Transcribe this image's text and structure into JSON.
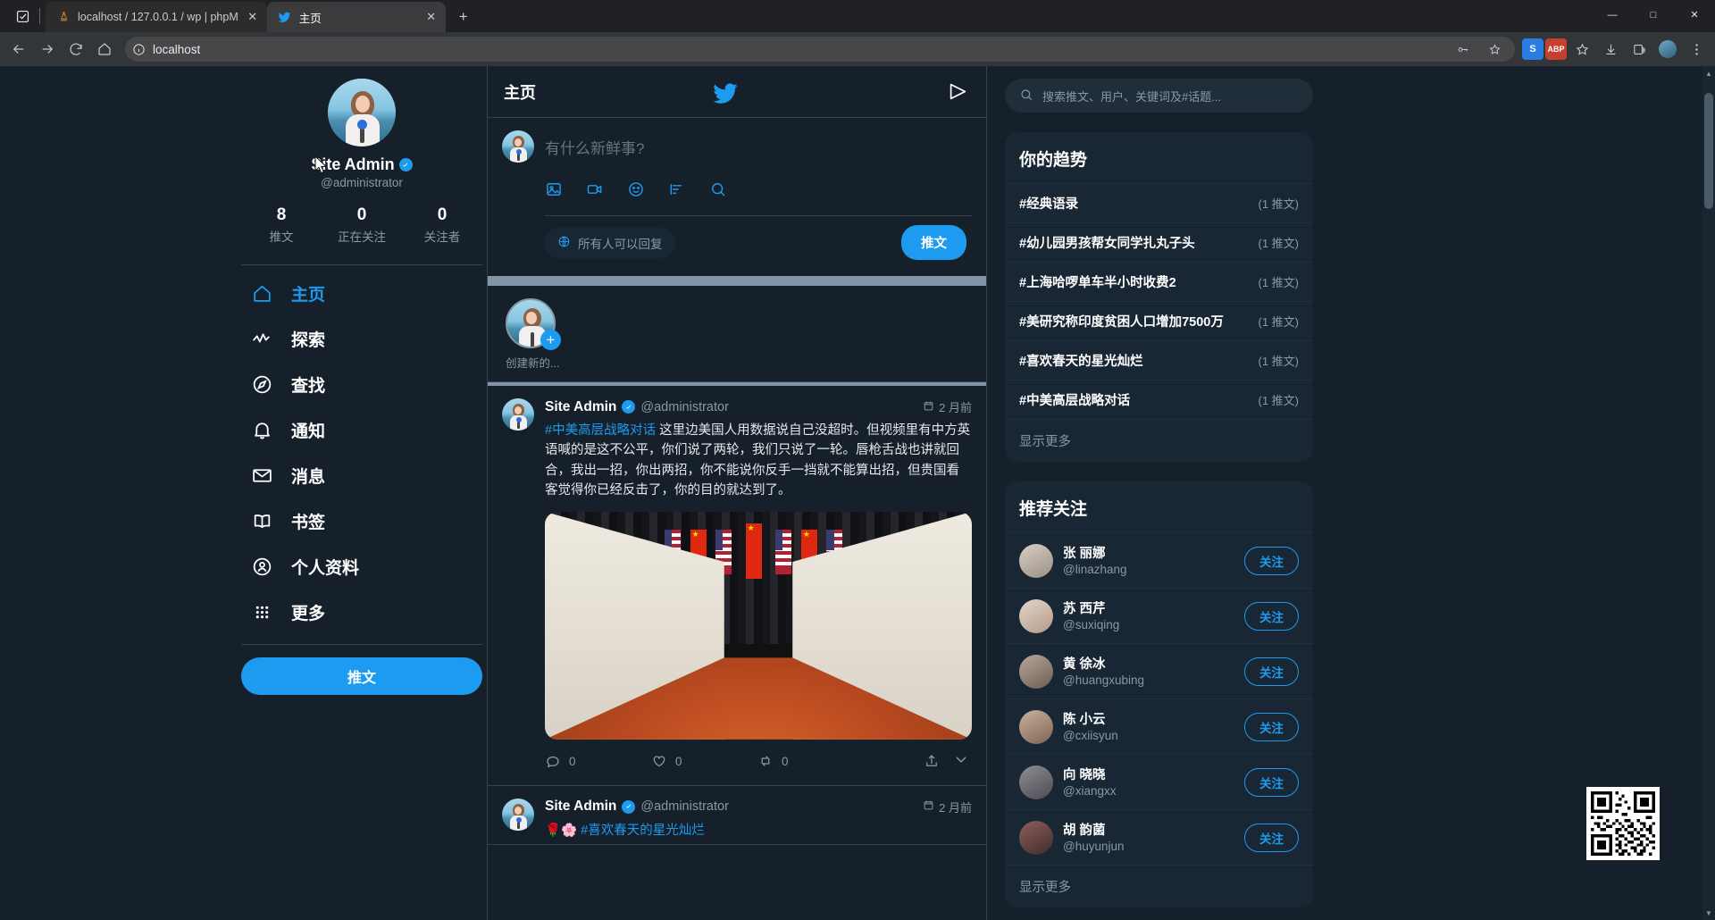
{
  "browser": {
    "tabs": [
      {
        "title": "localhost / 127.0.0.1 / wp | phpM",
        "favicon": "phpmyadmin-icon",
        "active": false
      },
      {
        "title": "主页",
        "favicon": "twitter-bird-icon",
        "active": true
      }
    ],
    "new_tab_label": "+",
    "address": "localhost",
    "window_controls": {
      "minimize": "—",
      "maximize": "□",
      "close": "✕"
    },
    "extensions": [
      {
        "name": "s-extension-icon",
        "label": "S",
        "color": "#2a7de1"
      },
      {
        "name": "abp-extension-icon",
        "label": "ABP",
        "color": "#c3412e"
      }
    ]
  },
  "profile": {
    "display_name": "Site Admin",
    "handle": "@administrator",
    "verified": true,
    "stats": [
      {
        "num": "8",
        "label": "推文"
      },
      {
        "num": "0",
        "label": "正在关注"
      },
      {
        "num": "0",
        "label": "关注者"
      }
    ]
  },
  "nav": {
    "items": [
      {
        "label": "主页",
        "icon": "home-icon",
        "active": true
      },
      {
        "label": "探索",
        "icon": "pulse-icon",
        "active": false
      },
      {
        "label": "查找",
        "icon": "compass-icon",
        "active": false
      },
      {
        "label": "通知",
        "icon": "bell-icon",
        "active": false
      },
      {
        "label": "消息",
        "icon": "mail-icon",
        "active": false
      },
      {
        "label": "书签",
        "icon": "bookmark-icon",
        "active": false
      },
      {
        "label": "个人资料",
        "icon": "person-icon",
        "active": false
      },
      {
        "label": "更多",
        "icon": "grid-dots-icon",
        "active": false
      }
    ],
    "tweet_button": "推文"
  },
  "center": {
    "header_title": "主页",
    "logo": "twitter-bird-icon",
    "send_icon": "send-icon",
    "composer": {
      "placeholder": "有什么新鲜事?",
      "tools": [
        "image-icon",
        "video-icon",
        "emoji-icon",
        "poll-icon",
        "search-icon"
      ],
      "audience_label": "所有人可以回复",
      "audience_icon": "globe-icon",
      "post_button": "推文"
    },
    "fleets": [
      {
        "label": "创建新的...",
        "badge": "+"
      }
    ],
    "tweets": [
      {
        "name": "Site Admin",
        "handle": "@administrator",
        "verified": true,
        "time": "2 月前",
        "hashtag": "#中美高层战略对话",
        "text": " 这里边美国人用数据说自己没超时。但视频里有中方英语喊的是这不公平，你们说了两轮，我们只说了一轮。唇枪舌战也讲就回合，我出一招，你出两招，你不能说你反手一挡就不能算出招，但贵国看客觉得你已经反击了，你的目的就达到了。",
        "has_image": true,
        "image_alt": "中美高层战略对话会议现场",
        "actions": [
          {
            "icon": "reply-icon",
            "count": "0"
          },
          {
            "icon": "heart-icon",
            "count": "0"
          },
          {
            "icon": "retweet-icon",
            "count": "0"
          },
          {
            "icon": "share-icon",
            "count": ""
          }
        ],
        "chevron": "chevron-down-icon"
      },
      {
        "name": "Site Admin",
        "handle": "@administrator",
        "verified": true,
        "time": "2 月前",
        "hashtag": "#喜欢春天的星光灿烂",
        "text": "",
        "prefix_emoji": "🌹🌸",
        "has_image": false,
        "actions": [],
        "chevron": "chevron-down-icon"
      }
    ]
  },
  "right": {
    "search_placeholder": "搜索推文、用户、关键词及#话题...",
    "search_icon": "search-icon",
    "trends": {
      "title": "你的趋势",
      "items": [
        {
          "name": "#经典语录",
          "count": "(1 推文)"
        },
        {
          "name": "#幼儿园男孩帮女同学扎丸子头",
          "count": "(1 推文)"
        },
        {
          "name": "#上海哈啰单车半小时收费2",
          "count": "(1 推文)"
        },
        {
          "name": "#美研究称印度贫困人口增加7500万",
          "count": "(1 推文)"
        },
        {
          "name": "#喜欢春天的星光灿烂",
          "count": "(1 推文)"
        },
        {
          "name": "#中美高层战略对话",
          "count": "(1 推文)"
        }
      ],
      "show_more": "显示更多"
    },
    "who_to_follow": {
      "title": "推荐关注",
      "items": [
        {
          "name": "张 丽娜",
          "handle": "@linazhang",
          "button": "关注"
        },
        {
          "name": "苏 西芹",
          "handle": "@suxiqing",
          "button": "关注"
        },
        {
          "name": "黄 徐冰",
          "handle": "@huangxubing",
          "button": "关注"
        },
        {
          "name": "陈 小云",
          "handle": "@cxiisyun",
          "button": "关注"
        },
        {
          "name": "向 晓晓",
          "handle": "@xiangxx",
          "button": "关注"
        },
        {
          "name": "胡 韵菌",
          "handle": "@huyunjun",
          "button": "关注"
        }
      ],
      "show_more": "显示更多"
    }
  },
  "overlay": {
    "qr_code": "qr-code-image",
    "cursor": "mouse-pointer"
  }
}
